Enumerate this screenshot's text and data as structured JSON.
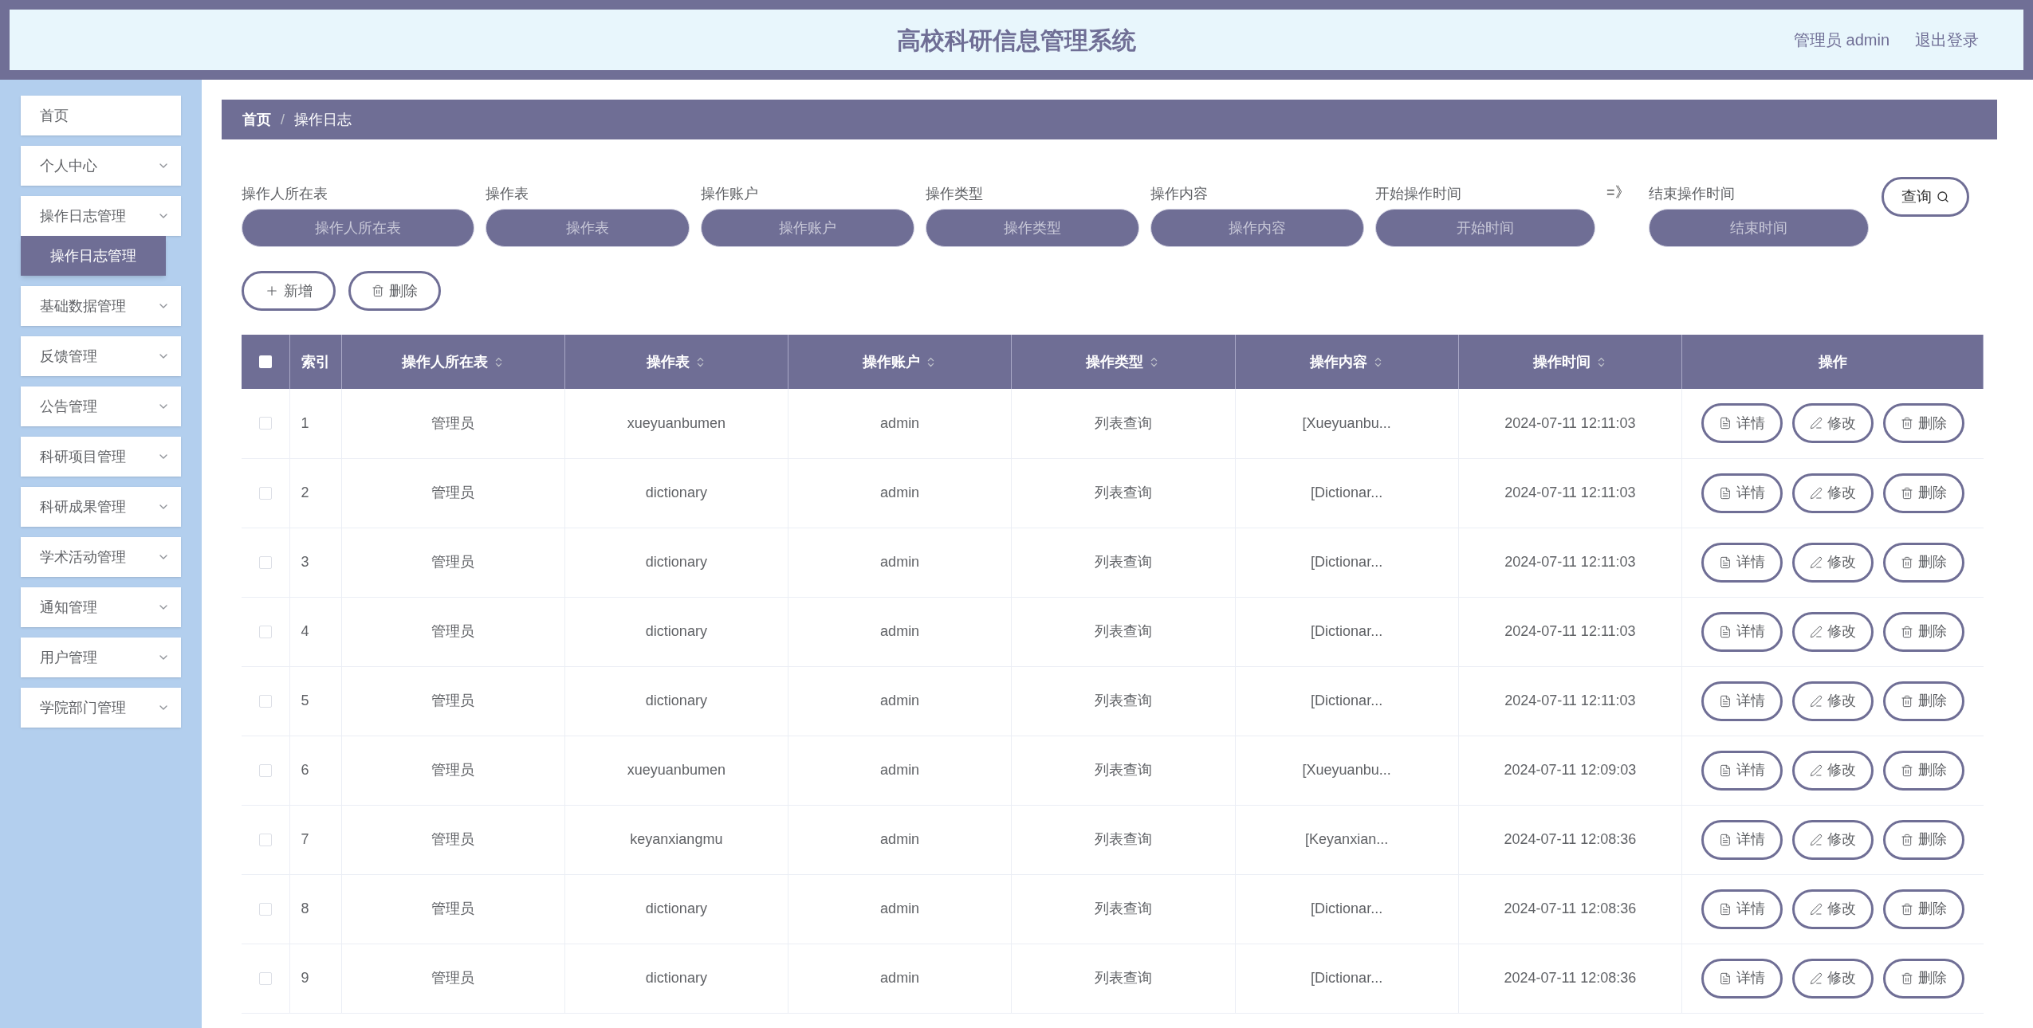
{
  "header": {
    "title": "高校科研信息管理系统",
    "user": "管理员 admin",
    "logout": "退出登录"
  },
  "sidebar": {
    "items": [
      {
        "label": "首页",
        "kind": "link"
      },
      {
        "label": "个人中心",
        "kind": "menu"
      },
      {
        "label": "操作日志管理",
        "kind": "menu",
        "children": [
          {
            "label": "操作日志管理",
            "selected": true
          }
        ]
      },
      {
        "label": "基础数据管理",
        "kind": "menu"
      },
      {
        "label": "反馈管理",
        "kind": "menu"
      },
      {
        "label": "公告管理",
        "kind": "menu"
      },
      {
        "label": "科研项目管理",
        "kind": "menu"
      },
      {
        "label": "科研成果管理",
        "kind": "menu"
      },
      {
        "label": "学术活动管理",
        "kind": "menu"
      },
      {
        "label": "通知管理",
        "kind": "menu"
      },
      {
        "label": "用户管理",
        "kind": "menu"
      },
      {
        "label": "学院部门管理",
        "kind": "menu"
      }
    ]
  },
  "breadcrumb": [
    {
      "label": "首页"
    },
    {
      "label": "操作日志",
      "separator": "/"
    }
  ],
  "filters": [
    {
      "label": "操作人所在表",
      "placeholder": "操作人所在表"
    },
    {
      "label": "操作表",
      "placeholder": "操作表"
    },
    {
      "label": "操作账户",
      "placeholder": "操作账户"
    },
    {
      "label": "操作类型",
      "placeholder": "操作类型"
    },
    {
      "label": "操作内容",
      "placeholder": "操作内容"
    },
    {
      "label": "开始操作时间",
      "placeholder": "开始时间"
    },
    {
      "label": "结束操作时间",
      "placeholder": "结束时间",
      "prefix": "=》"
    }
  ],
  "search_button": "查询",
  "toolbar": [
    {
      "label": "新增",
      "kind": "add"
    },
    {
      "label": "删除",
      "kind": "delete"
    }
  ],
  "table": {
    "select_all_checked": false,
    "columns": [
      {
        "label": "索引",
        "sortable": false
      },
      {
        "label": "操作人所在表",
        "sortable": true
      },
      {
        "label": "操作表",
        "sortable": true
      },
      {
        "label": "操作账户",
        "sortable": true
      },
      {
        "label": "操作类型",
        "sortable": true
      },
      {
        "label": "操作内容",
        "sortable": true
      },
      {
        "label": "操作时间",
        "sortable": true
      },
      {
        "label": "操作",
        "sortable": false
      }
    ],
    "rows": [
      {
        "checked": false,
        "cells": [
          "1",
          "管理员",
          "xueyuanbumen",
          "admin",
          "列表查询",
          "[Xueyuanbu...",
          "2024-07-11 12:11:03"
        ],
        "actions": [
          "详情",
          "修改",
          "删除"
        ]
      },
      {
        "checked": false,
        "cells": [
          "2",
          "管理员",
          "dictionary",
          "admin",
          "列表查询",
          "[Dictionar...",
          "2024-07-11 12:11:03"
        ],
        "actions": [
          "详情",
          "修改",
          "删除"
        ]
      },
      {
        "checked": false,
        "cells": [
          "3",
          "管理员",
          "dictionary",
          "admin",
          "列表查询",
          "[Dictionar...",
          "2024-07-11 12:11:03"
        ],
        "actions": [
          "详情",
          "修改",
          "删除"
        ]
      },
      {
        "checked": false,
        "cells": [
          "4",
          "管理员",
          "dictionary",
          "admin",
          "列表查询",
          "[Dictionar...",
          "2024-07-11 12:11:03"
        ],
        "actions": [
          "详情",
          "修改",
          "删除"
        ]
      },
      {
        "checked": false,
        "cells": [
          "5",
          "管理员",
          "dictionary",
          "admin",
          "列表查询",
          "[Dictionar...",
          "2024-07-11 12:11:03"
        ],
        "actions": [
          "详情",
          "修改",
          "删除"
        ]
      },
      {
        "checked": false,
        "cells": [
          "6",
          "管理员",
          "xueyuanbumen",
          "admin",
          "列表查询",
          "[Xueyuanbu...",
          "2024-07-11 12:09:03"
        ],
        "actions": [
          "详情",
          "修改",
          "删除"
        ]
      },
      {
        "checked": false,
        "cells": [
          "7",
          "管理员",
          "keyanxiangmu",
          "admin",
          "列表查询",
          "[Keyanxian...",
          "2024-07-11 12:08:36"
        ],
        "actions": [
          "详情",
          "修改",
          "删除"
        ]
      },
      {
        "checked": false,
        "cells": [
          "8",
          "管理员",
          "dictionary",
          "admin",
          "列表查询",
          "[Dictionar...",
          "2024-07-11 12:08:36"
        ],
        "actions": [
          "详情",
          "修改",
          "删除"
        ]
      },
      {
        "checked": false,
        "cells": [
          "9",
          "管理员",
          "dictionary",
          "admin",
          "列表查询",
          "[Dictionar...",
          "2024-07-11 12:08:36"
        ],
        "actions": [
          "详情",
          "修改",
          "删除"
        ]
      }
    ]
  }
}
